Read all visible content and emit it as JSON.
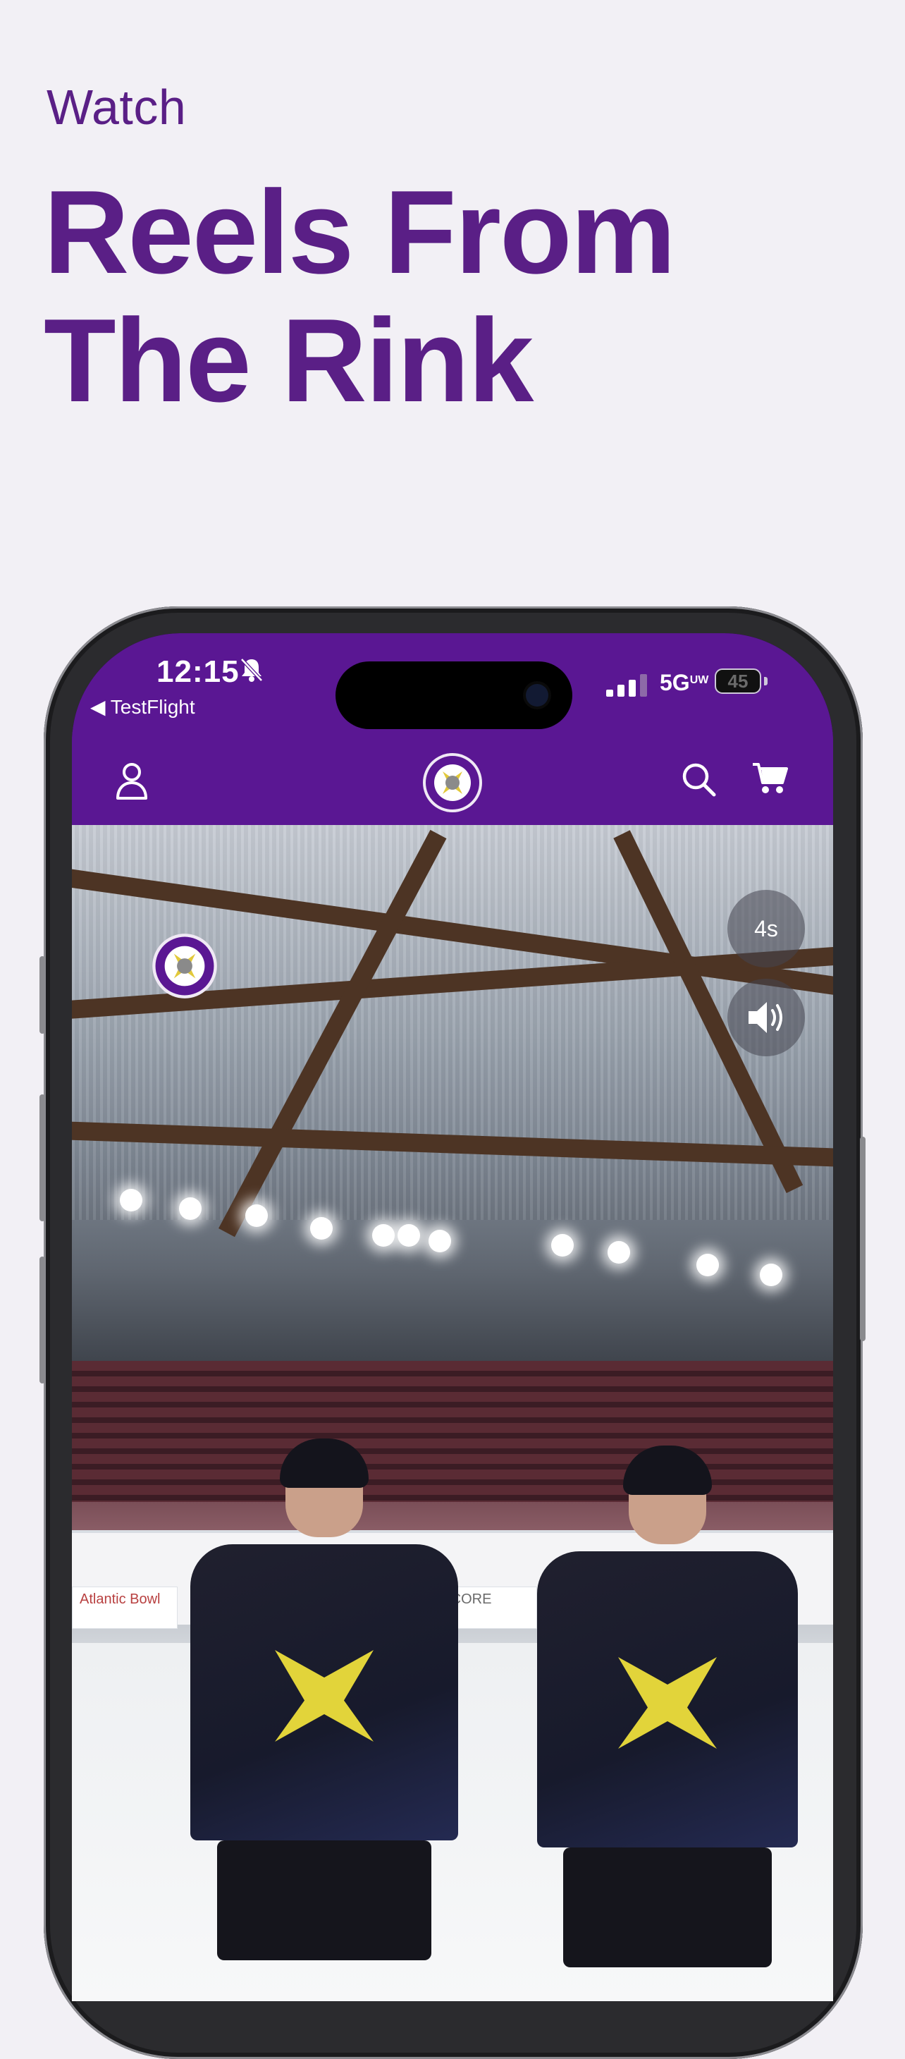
{
  "intro": {
    "eyebrow": "Watch",
    "headline_line1": "Reels From",
    "headline_line2": "The Rink"
  },
  "status_bar": {
    "time": "12:15",
    "back_app": "◀ TestFlight",
    "network": "5G",
    "network_suffix": "UW",
    "battery": "45"
  },
  "app_header": {
    "left_icon": "profile-icon",
    "center_logo": "manchester-storm-logo",
    "right_icons": [
      "search-icon",
      "cart-icon"
    ]
  },
  "reel": {
    "timer": "4s",
    "sound_icon": "speaker-on-icon",
    "ad_boards": [
      "Atlantic Bowl",
      "PSCORE"
    ]
  },
  "colors": {
    "brand_purple": "#5a1793",
    "headline_purple": "#5a1f86",
    "background": "#f2f0f5"
  }
}
